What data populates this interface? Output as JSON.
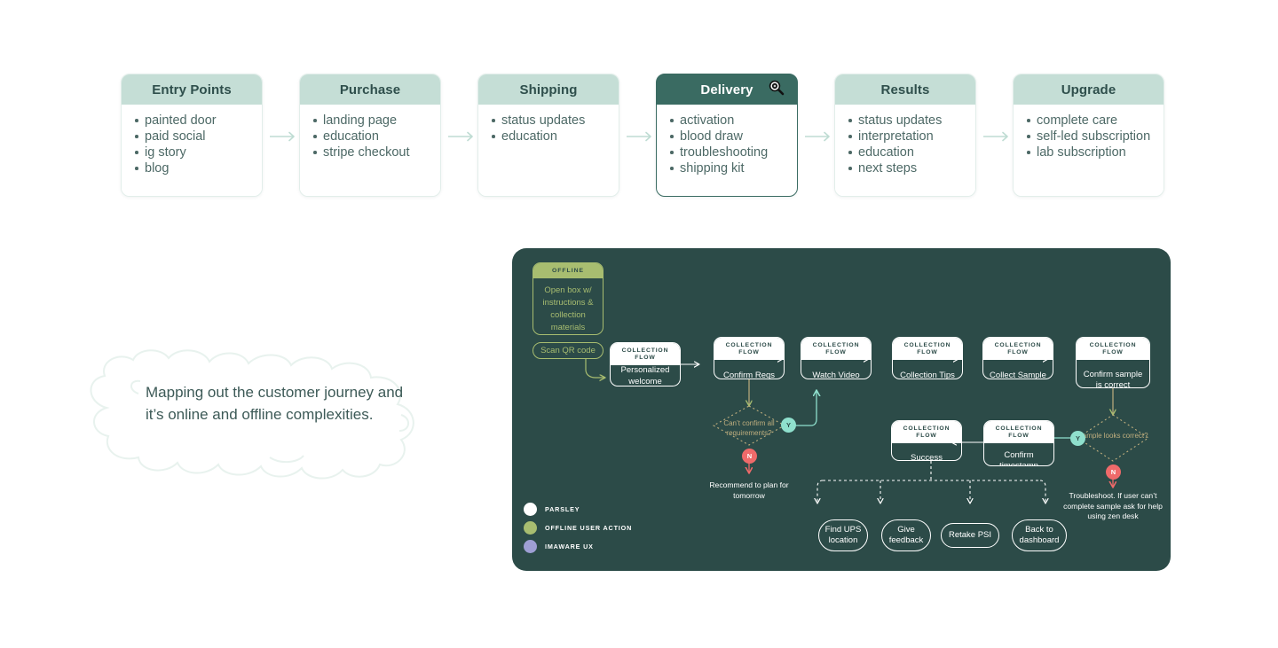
{
  "journey": {
    "arrow_color": "#bfdcd3",
    "cards": [
      {
        "title": "Entry Points",
        "active": false,
        "items": [
          "painted door",
          "paid social",
          "ig story",
          "blog"
        ]
      },
      {
        "title": "Purchase",
        "active": false,
        "items": [
          "landing page",
          "education",
          "stripe checkout"
        ]
      },
      {
        "title": "Shipping",
        "active": false,
        "items": [
          "status updates",
          "education"
        ]
      },
      {
        "title": "Delivery",
        "active": true,
        "icon": "zoom-in-cursor-icon",
        "items": [
          "activation",
          "blood draw",
          "troubleshooting",
          "shipping kit"
        ]
      },
      {
        "title": "Results",
        "active": false,
        "items": [
          "status updates",
          "interpretation",
          "education",
          "next steps"
        ]
      },
      {
        "title": "Upgrade",
        "active": false,
        "items": [
          "complete care",
          "self-led subscription",
          "lab subscription"
        ]
      }
    ]
  },
  "cloud_note": {
    "text": "Mapping out the customer journey and it’s online and offline complexities."
  },
  "flow": {
    "panel_color": "#2c4b48",
    "offline_card": {
      "head": "OFFLINE",
      "body": "Open box w/ instructions & collection materials"
    },
    "scan_pill": "Scan QR code",
    "nodes": [
      {
        "head": "COLLECTION FLOW",
        "body": "Personalized welcome message"
      },
      {
        "head": "COLLECTION FLOW",
        "body": "Confirm Reqs"
      },
      {
        "head": "COLLECTION FLOW",
        "body": "Watch Video"
      },
      {
        "head": "COLLECTION FLOW",
        "body": "Collection Tips"
      },
      {
        "head": "COLLECTION FLOW",
        "body": "Collect Sample"
      },
      {
        "head": "COLLECTION FLOW",
        "body": "Confirm sample is correct"
      },
      {
        "head": "COLLECTION FLOW",
        "body": "Success"
      },
      {
        "head": "COLLECTION FLOW",
        "body": "Confirm timestamp"
      }
    ],
    "decisions": [
      {
        "label": "Can’t confirm all requirements?",
        "yes": "Y",
        "no": "N"
      },
      {
        "label": "Sample looks correct?",
        "yes": "Y",
        "no": "N"
      }
    ],
    "notes": [
      "Recommend to plan for tomorrow",
      "Troubleshoot. If user can’t complete sample ask for help using zen desk"
    ],
    "end_pills": [
      "Find UPS location",
      "Give feedback",
      "Retake PSI",
      "Back to dashboard"
    ],
    "legend": [
      {
        "label": "PARSLEY",
        "color": "#ffffff"
      },
      {
        "label": "OFFLINE USER ACTION",
        "color": "#a8bd70"
      },
      {
        "label": "IMAWARE UX",
        "color": "#9e9fd4"
      }
    ]
  }
}
